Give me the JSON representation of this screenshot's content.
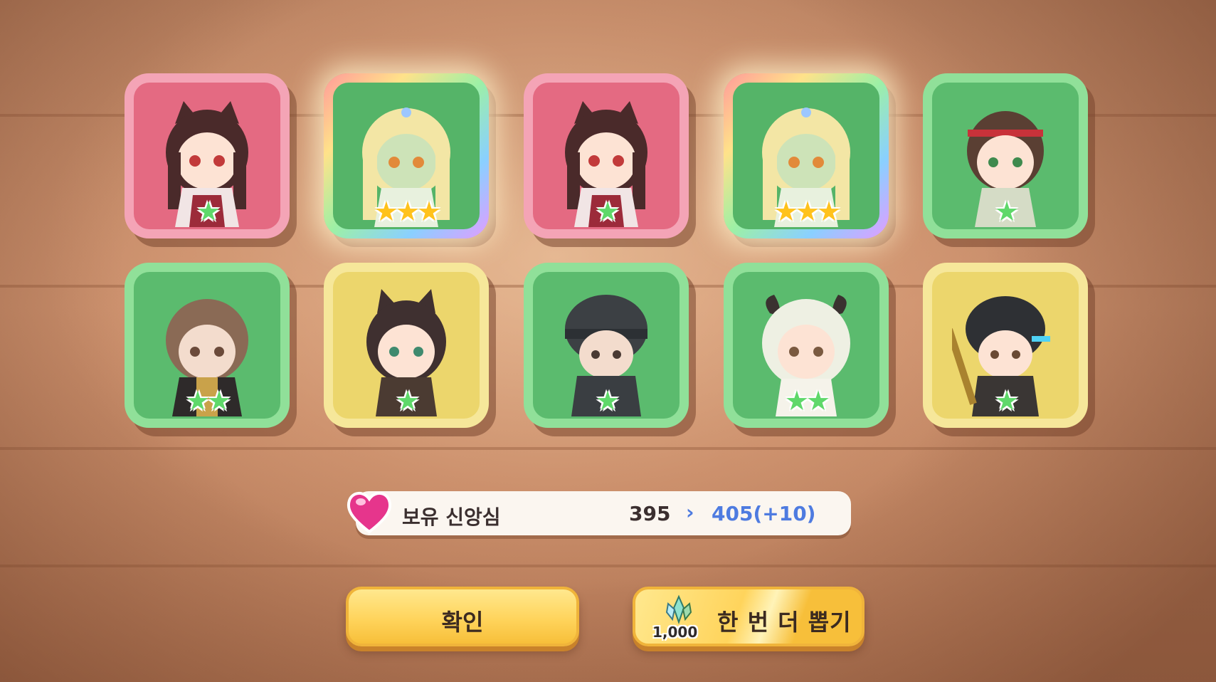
{
  "theme": {
    "button_color": "#ffd45c",
    "faith_new_color": "#4e7be0",
    "star_green": "#5fd86a",
    "star_gold": "#ffc21c"
  },
  "results": [
    {
      "rarity_frame": "pink",
      "stars": 1,
      "star_color": "green",
      "stars_text": "★"
    },
    {
      "rarity_frame": "rainbow",
      "stars": 3,
      "star_color": "gold",
      "stars_text": "★★★"
    },
    {
      "rarity_frame": "pink",
      "stars": 1,
      "star_color": "green",
      "stars_text": "★"
    },
    {
      "rarity_frame": "rainbow",
      "stars": 3,
      "star_color": "gold",
      "stars_text": "★★★"
    },
    {
      "rarity_frame": "green",
      "stars": 1,
      "star_color": "green",
      "stars_text": "★"
    },
    {
      "rarity_frame": "green",
      "stars": 2,
      "star_color": "green",
      "stars_text": "★★"
    },
    {
      "rarity_frame": "yellow",
      "stars": 1,
      "star_color": "green",
      "stars_text": "★"
    },
    {
      "rarity_frame": "green",
      "stars": 1,
      "star_color": "green",
      "stars_text": "★"
    },
    {
      "rarity_frame": "green",
      "stars": 2,
      "star_color": "green",
      "stars_text": "★★"
    },
    {
      "rarity_frame": "yellow",
      "stars": 1,
      "star_color": "green",
      "stars_text": "★"
    }
  ],
  "faith": {
    "label": "보유 신앙심",
    "current": "395",
    "arrow": "›",
    "new_value": "405(+10)"
  },
  "buttons": {
    "confirm_label": "확인",
    "draw_again_label": "한 번 더 뽑기",
    "draw_again_cost": "1,000"
  },
  "icons": {
    "heart": "heart-icon",
    "crystal": "crystal-icon",
    "star": "star-icon"
  }
}
